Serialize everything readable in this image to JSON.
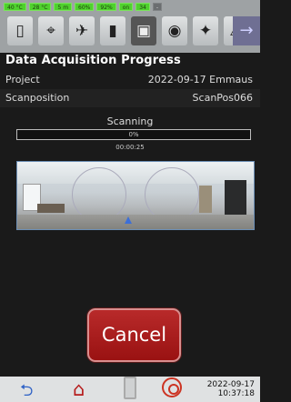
{
  "status": {
    "chips": [
      "40 °C",
      "28 °C",
      "5 m",
      "60%",
      "92%",
      "on",
      "34",
      "-"
    ]
  },
  "toolbar": {
    "icons": [
      "scanner-icon",
      "scan-position-icon",
      "satellite-icon",
      "battery-icon",
      "storage-card-icon",
      "camera-icon",
      "inclination-icon",
      "laptop-warning-icon"
    ],
    "nav_arrow": "→"
  },
  "page": {
    "title": "Data Acquisition Progress",
    "project_label": "Project",
    "project_value": "2022-09-17 Emmaus",
    "scanposition_label": "Scanposition",
    "scanposition_value": "ScanPos066"
  },
  "progress": {
    "status_text": "Scanning",
    "percent_text": "0%",
    "fraction": 0.0,
    "elapsed": "00:00:25"
  },
  "actions": {
    "cancel_label": "Cancel"
  },
  "bottom": {
    "date": "2022-09-17",
    "time": "10:37:18"
  },
  "colors": {
    "progress_fill": "#4fd12d",
    "cancel_bg": "#b82a2a",
    "back_arrow": "#2f62c6",
    "home": "#b61d1d"
  }
}
